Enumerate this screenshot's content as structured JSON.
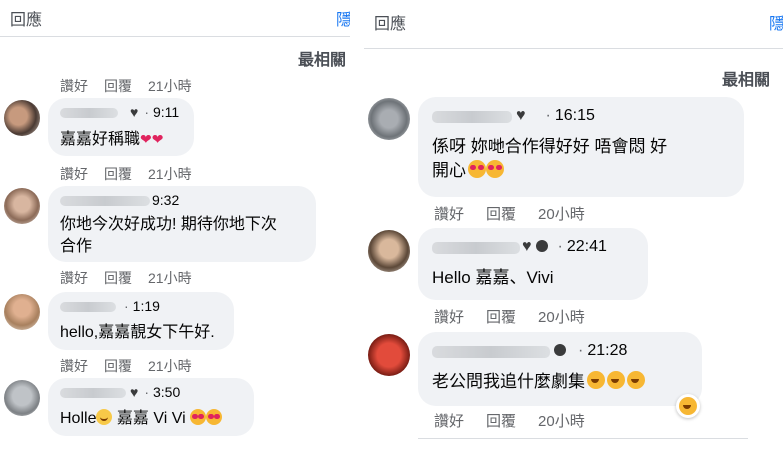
{
  "left": {
    "header": {
      "reply_label": "回應",
      "edge_label": "隱"
    },
    "sort_label": "最相關",
    "top_actions": {
      "like": "讚好",
      "reply": "回覆",
      "time": "21小時"
    },
    "comments": [
      {
        "time": "9:11",
        "text": "嘉嘉好稱職",
        "actions": {
          "like": "讚好",
          "reply": "回覆",
          "time": "21小時"
        }
      },
      {
        "time": "9:32",
        "text_line1": "你地今次好成功! 期待你地下次",
        "text_line2": "合作",
        "actions": {
          "like": "讚好",
          "reply": "回覆",
          "time": "21小時"
        }
      },
      {
        "time": "1:19",
        "text": "hello,嘉嘉靚女下午好.",
        "actions": {
          "like": "讚好",
          "reply": "回覆",
          "time": "21小時"
        }
      },
      {
        "time": "3:50",
        "text_a": "Holle",
        "text_b": "嘉嘉 Vi Vi"
      }
    ]
  },
  "right": {
    "header": {
      "reply_label": "回應",
      "edge_label": "隱"
    },
    "sort_label": "最相關",
    "comments": [
      {
        "time": "16:15",
        "text_line1": "係呀 妳哋合作得好好 唔會悶 好",
        "text_line2": "開心",
        "actions": {
          "like": "讚好",
          "reply": "回覆",
          "time": "20小時"
        }
      },
      {
        "time": "22:41",
        "text": "Hello 嘉嘉、Vivi",
        "actions": {
          "like": "讚好",
          "reply": "回覆",
          "time": "20小時"
        }
      },
      {
        "time": "21:28",
        "text": "老公問我追什麼劇集",
        "actions": {
          "like": "讚好",
          "reply": "回覆",
          "time": "20小時"
        }
      }
    ]
  },
  "colors": {
    "bubble": "#f0f2f5",
    "meta_gray": "#65676b",
    "link_blue": "#1877f2",
    "rule": "#dadde1"
  },
  "icons": [
    "heart-icon",
    "dot-icon",
    "love-face-emoji",
    "laugh-emoji",
    "smile-emoji",
    "hearts-emoji"
  ]
}
